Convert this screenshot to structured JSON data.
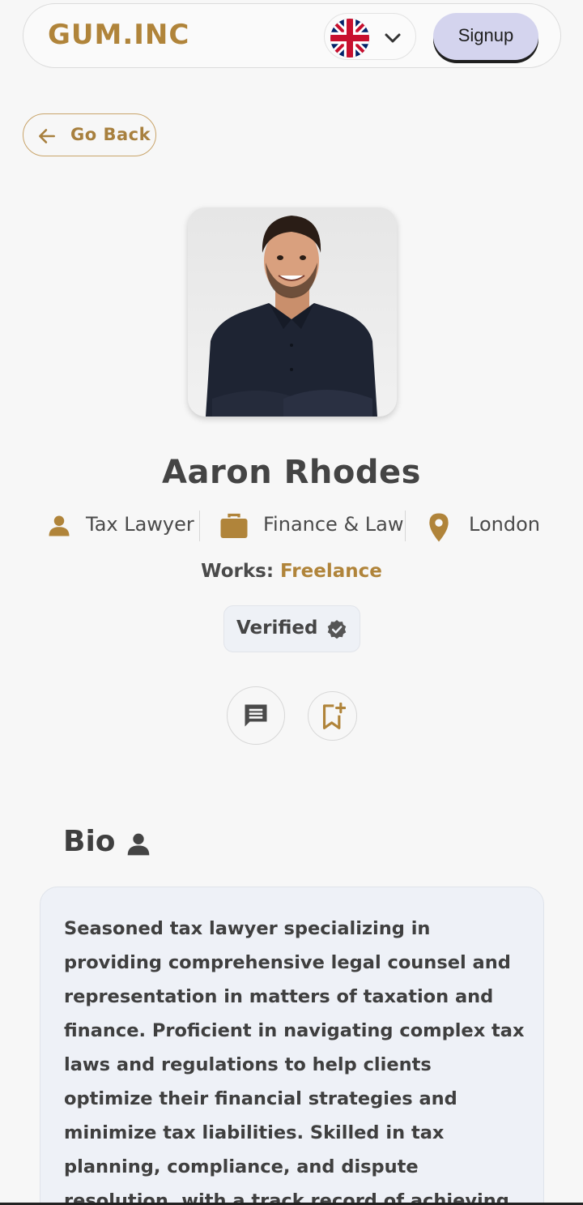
{
  "header": {
    "logo": "GUM.INC",
    "language": "English (UK)",
    "signup_label": "Signup"
  },
  "nav": {
    "back_label": "Go Back"
  },
  "profile": {
    "name": "Aaron Rhodes",
    "title": "Tax Lawyer",
    "industry": "Finance & Law",
    "location": "London",
    "works_label": "Works:",
    "works_value": "Freelance",
    "verified_label": "Verified"
  },
  "bio": {
    "heading": "Bio",
    "text": "Seasoned tax lawyer specializing in providing comprehensive legal counsel and representation in matters of taxation and finance. Proficient in navigating complex tax laws and regulations to help clients optimize their financial strategies and minimize tax liabilities. Skilled in tax planning, compliance, and dispute resolution, with a track record of achieving favorable outcomes"
  },
  "colors": {
    "accent": "#b0843a",
    "signup_bg": "#d4d4ee",
    "card_bg": "#eef1f7",
    "text": "#3f3f3f"
  },
  "icons": [
    "arrow-left-icon",
    "uk-flag-icon",
    "chevron-down-icon",
    "person-icon",
    "briefcase-icon",
    "location-pin-icon",
    "verified-badge-icon",
    "message-icon",
    "bookmark-add-icon"
  ]
}
